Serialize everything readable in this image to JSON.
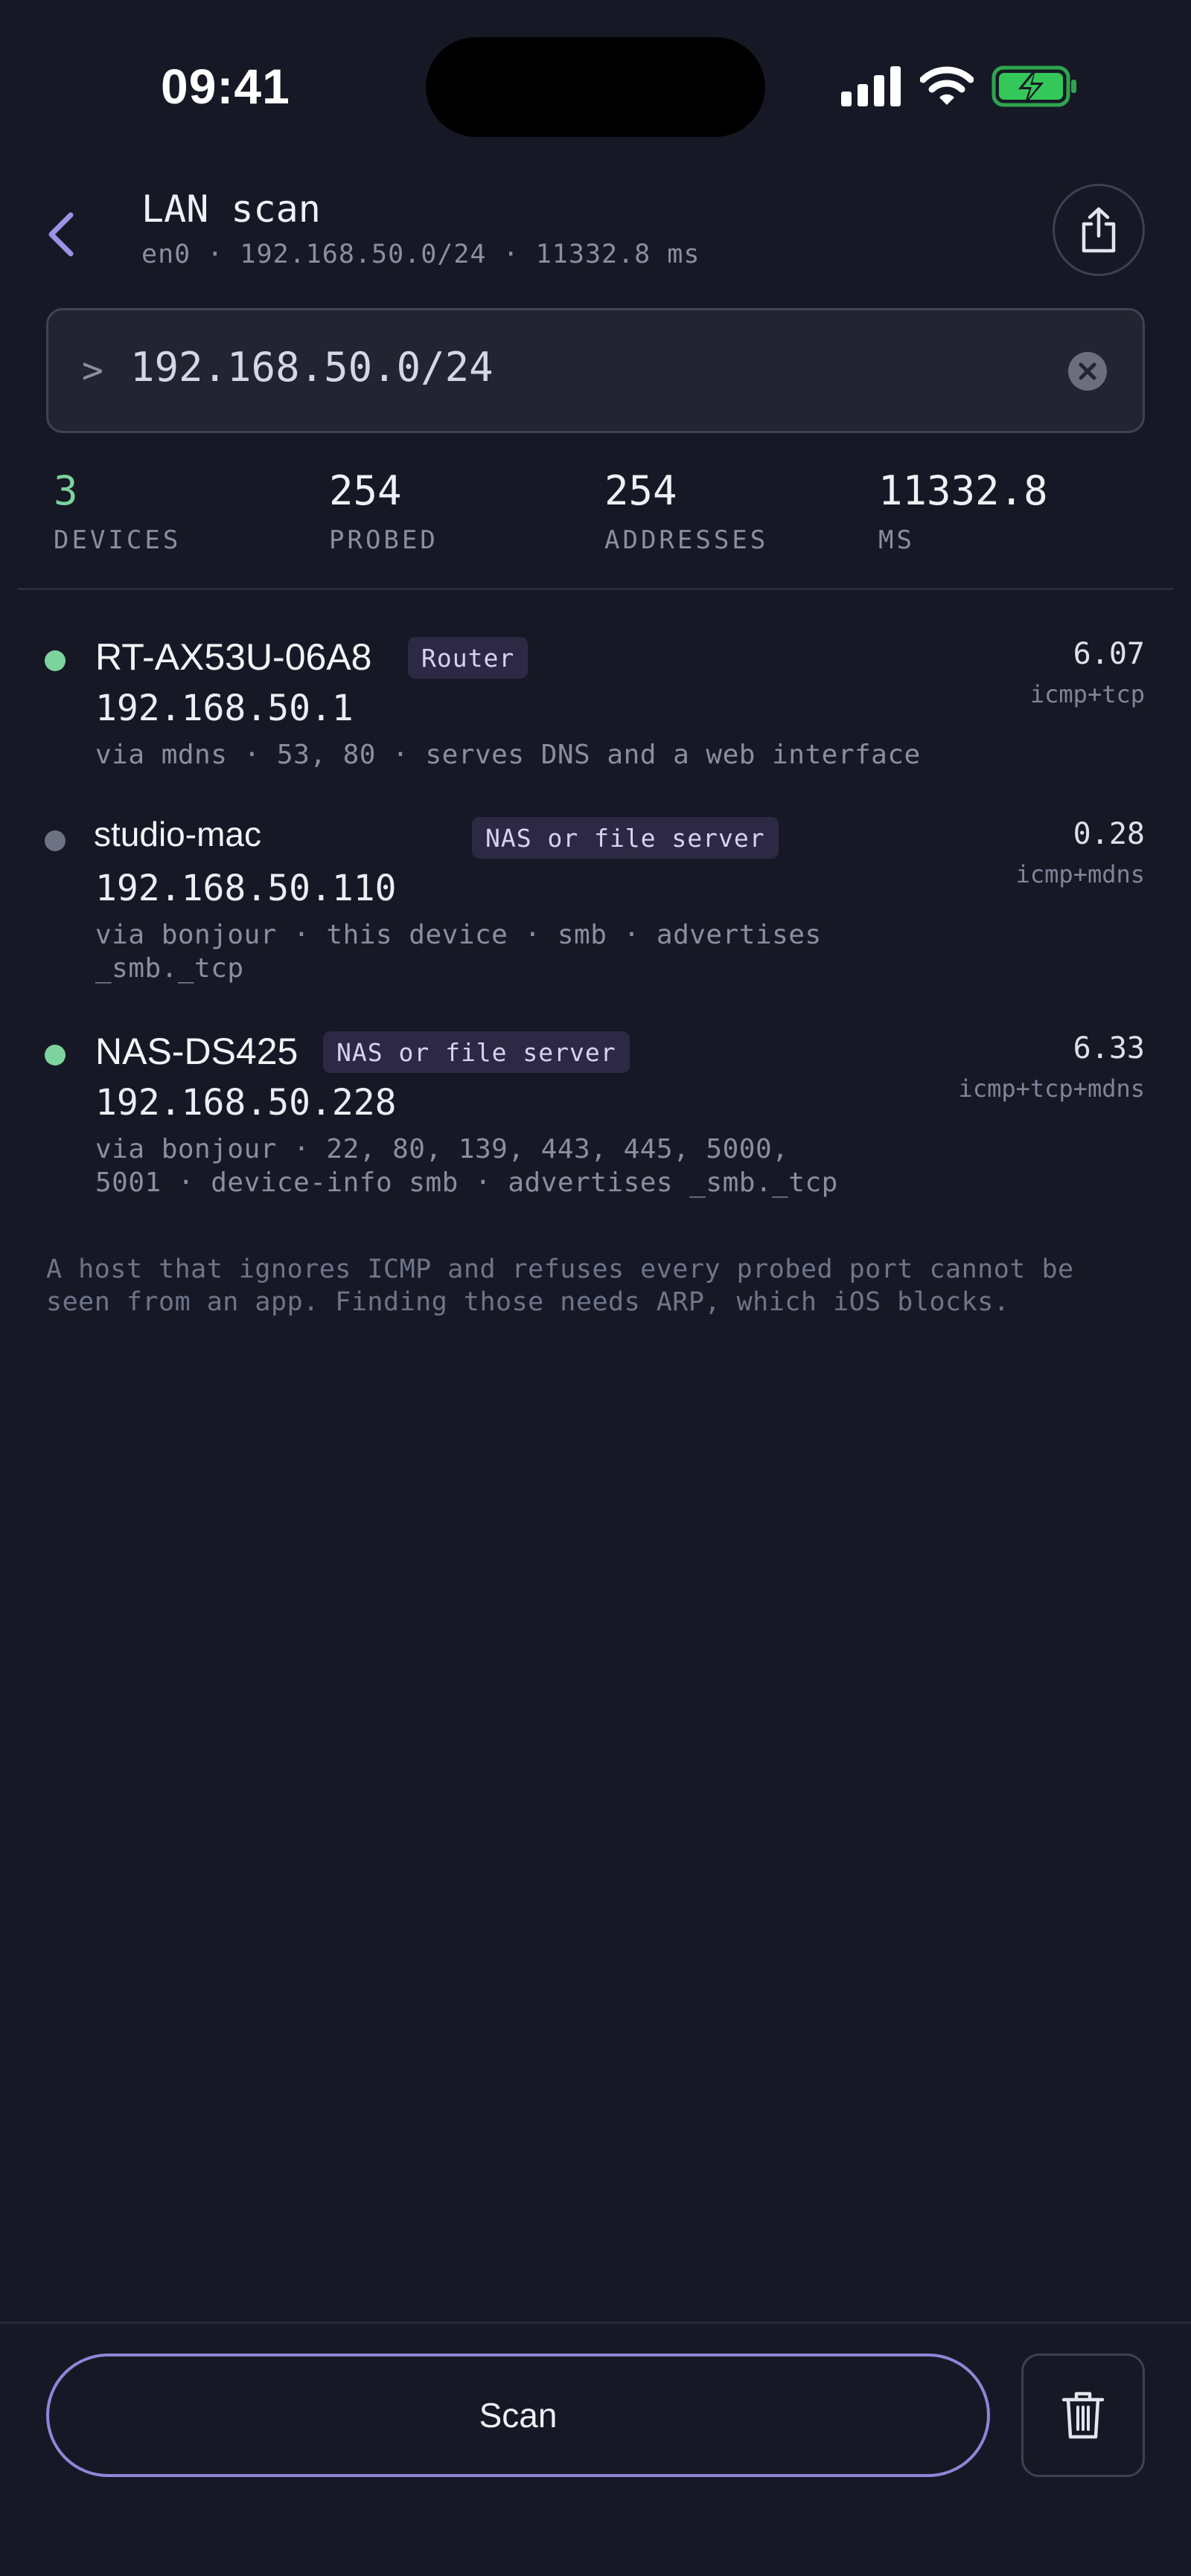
{
  "status_bar": {
    "time": "09:41"
  },
  "header": {
    "title": "LAN scan",
    "subtitle": "en0 · 192.168.50.0/24 · 11332.8 ms"
  },
  "target_input": {
    "prompt": ">",
    "value": "192.168.50.0/24"
  },
  "stats": [
    {
      "value": "3",
      "label": "DEVICES"
    },
    {
      "value": "254",
      "label": "PROBED"
    },
    {
      "value": "254",
      "label": "ADDRESSES"
    },
    {
      "value": "11332.8",
      "label": "MS"
    }
  ],
  "devices": [
    {
      "name": "RT-AX53U-06A8",
      "badge": "Router",
      "ip": "192.168.50.1",
      "meta": [
        "via mdns · 53, 80 · serves DNS and a web interface"
      ],
      "rtt": "6.07",
      "method": "icmp+tcp",
      "status_color": "#7cd39e"
    },
    {
      "name": "studio-mac",
      "badge": "NAS or file server",
      "ip": "192.168.50.110",
      "meta": [
        "via bonjour · this device · smb · advertises",
        "_smb._tcp"
      ],
      "rtt": "0.28",
      "method": "icmp+mdns",
      "status_color": "#6e7282"
    },
    {
      "name": "NAS-DS425",
      "badge": "NAS or file server",
      "ip": "192.168.50.228",
      "meta": [
        "via bonjour · 22, 80, 139, 443, 445, 5000,",
        "5001 · device-info smb · advertises _smb._tcp"
      ],
      "rtt": "6.33",
      "method": "icmp+tcp+mdns",
      "status_color": "#7cd39e"
    }
  ],
  "note": [
    "A host that ignores ICMP and refuses every probed port cannot be",
    "seen from an app. Finding those needs ARP, which iOS blocks."
  ],
  "actions": {
    "scan_label": "Scan"
  },
  "colors": {
    "accent": "#7cd39e",
    "button_border": "#8f86d8",
    "battery": "#34c759"
  },
  "icons": [
    "back-chevron-icon",
    "share-icon",
    "clear-icon",
    "trash-icon",
    "signal-icon",
    "wifi-icon",
    "battery-charging-icon"
  ]
}
